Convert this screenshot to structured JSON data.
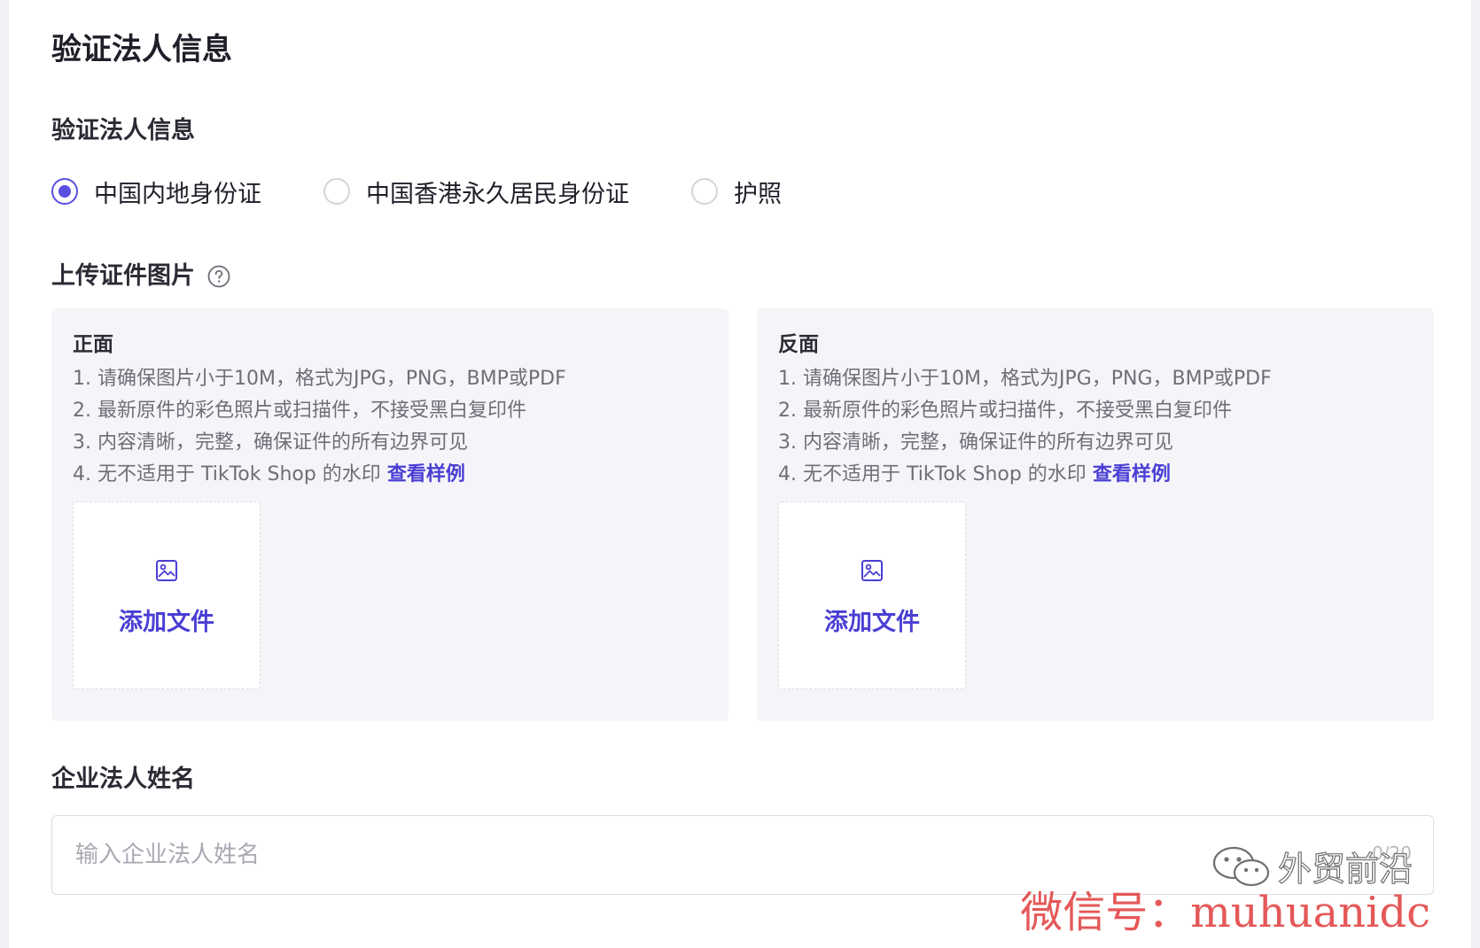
{
  "page": {
    "title": "验证法人信息"
  },
  "legal_type": {
    "label": "验证法人信息",
    "options": [
      {
        "label": "中国内地身份证",
        "checked": true
      },
      {
        "label": "中国香港永久居民身份证",
        "checked": false
      },
      {
        "label": "护照",
        "checked": false
      }
    ]
  },
  "upload": {
    "label": "上传证件图片",
    "help_icon": "question-circle-icon",
    "front": {
      "title": "正面",
      "rules": [
        "1. 请确保图片小于10M，格式为JPG，PNG，BMP或PDF",
        "2. 最新原件的彩色照片或扫描件，不接受黑白复印件",
        "3. 内容清晰，完整，确保证件的所有边界可见",
        "4. 无不适用于 TikTok Shop 的水印 "
      ],
      "sample_link": "查看样例",
      "add_file": "添加文件",
      "icon": "image-icon"
    },
    "back": {
      "title": "反面",
      "rules": [
        "1. 请确保图片小于10M，格式为JPG，PNG，BMP或PDF",
        "2. 最新原件的彩色照片或扫描件，不接受黑白复印件",
        "3. 内容清晰，完整，确保证件的所有边界可见",
        "4. 无不适用于 TikTok Shop 的水印 "
      ],
      "sample_link": "查看样例",
      "add_file": "添加文件",
      "icon": "image-icon"
    }
  },
  "legal_name": {
    "label": "企业法人姓名",
    "placeholder": "输入企业法人姓名",
    "value": "",
    "count": "0/20"
  },
  "watermark": {
    "account_name": "外贸前沿",
    "wechat_id": "微信号：muhuanidc",
    "icon": "wechat-icon"
  },
  "colors": {
    "accent": "#5a4fe0",
    "link": "#4a3fd4",
    "card_bg": "#f5f5f9",
    "watermark_red": "#e34a4a"
  }
}
